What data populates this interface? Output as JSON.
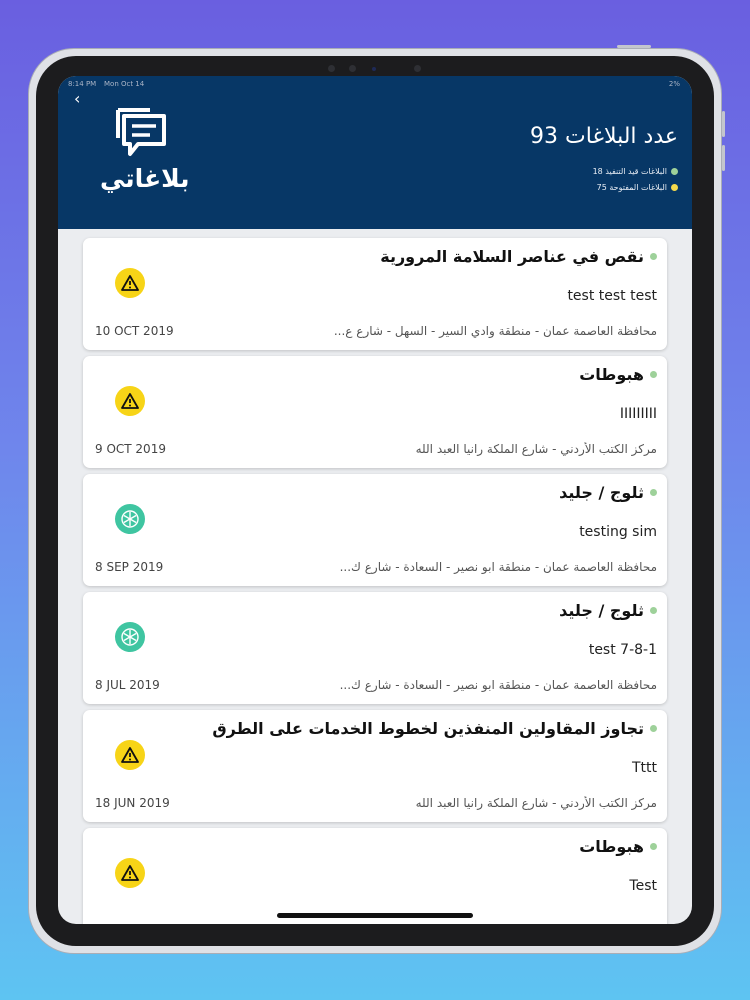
{
  "status": {
    "time": "8:14 PM",
    "date": "Mon Oct 14",
    "battery": "2%"
  },
  "header": {
    "logo_text": "بلاغاتي",
    "count_title": "عدد البلاغات 93",
    "stats": [
      {
        "label": "البلاغات قيد التنفيذ 18",
        "color": "#9ed19a"
      },
      {
        "label": "البلاغات المفتوحة 75",
        "color": "#f4d94c"
      }
    ]
  },
  "colors": {
    "header_bg": "#073766",
    "warning": "#f7d417",
    "snow": "#3fc5a1"
  },
  "reports": [
    {
      "title": "نقص في عناصر السلامة المرورية",
      "description": "test test test",
      "location": "محافظة العاصمة عمان - منطقة وادي السير - السهل - شارع ع...",
      "date": "10 OCT 2019",
      "icon": "warning-icon"
    },
    {
      "title": "هبوطات",
      "description": "IIIIIIIII",
      "location": "مركز الكتب الأردني - شارع الملكة رانيا العبد الله",
      "date": "9 OCT 2019",
      "icon": "warning-icon"
    },
    {
      "title": "ثلوج / جليد",
      "description": "testing sim",
      "location": "محافظة العاصمة عمان - منطقة ابو نصير - السعادة - شارع ك...",
      "date": "8 SEP 2019",
      "icon": "snowflake-icon"
    },
    {
      "title": "ثلوج / جليد",
      "description": "test 7-8-1",
      "location": "محافظة العاصمة عمان - منطقة ابو نصير - السعادة - شارع ك...",
      "date": "8 JUL 2019",
      "icon": "snowflake-icon"
    },
    {
      "title": "تجاوز المقاولين المنفذين لخطوط الخدمات على الطرق",
      "description": "Tttt",
      "location": "مركز الكتب الأردني - شارع الملكة رانيا العبد الله",
      "date": "18 JUN 2019",
      "icon": "warning-icon"
    },
    {
      "title": "هبوطات",
      "description": "Test",
      "location": "",
      "date": "",
      "icon": "warning-icon"
    }
  ]
}
